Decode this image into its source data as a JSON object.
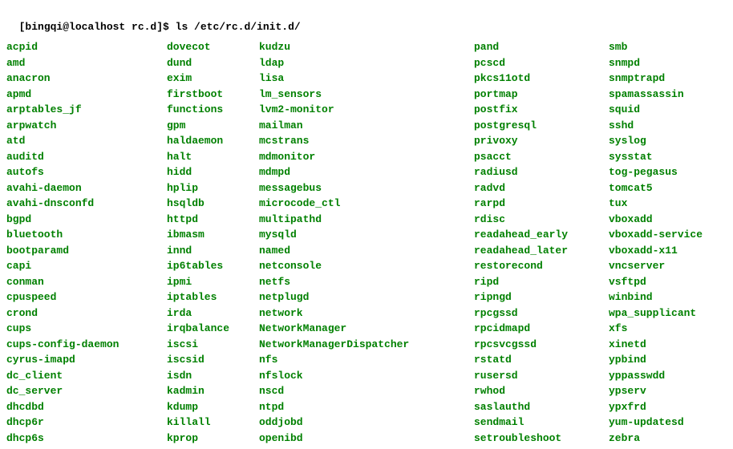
{
  "prompt": {
    "user_host": "[bingqi@localhost rc.d]$",
    "command": "ls /etc/rc.d/init.d/"
  },
  "columns": [
    [
      "acpid",
      "amd",
      "anacron",
      "apmd",
      "arptables_jf",
      "arpwatch",
      "atd",
      "auditd",
      "autofs",
      "avahi-daemon",
      "avahi-dnsconfd",
      "bgpd",
      "bluetooth",
      "bootparamd",
      "capi",
      "conman",
      "cpuspeed",
      "crond",
      "cups",
      "cups-config-daemon",
      "cyrus-imapd",
      "dc_client",
      "dc_server",
      "dhcdbd",
      "dhcp6r",
      "dhcp6s"
    ],
    [
      "dovecot",
      "dund",
      "exim",
      "firstboot",
      "functions",
      "gpm",
      "haldaemon",
      "halt",
      "hidd",
      "hplip",
      "hsqldb",
      "httpd",
      "ibmasm",
      "innd",
      "ip6tables",
      "ipmi",
      "iptables",
      "irda",
      "irqbalance",
      "iscsi",
      "iscsid",
      "isdn",
      "kadmin",
      "kdump",
      "killall",
      "kprop"
    ],
    [
      "kudzu",
      "ldap",
      "lisa",
      "lm_sensors",
      "lvm2-monitor",
      "mailman",
      "mcstrans",
      "mdmonitor",
      "mdmpd",
      "messagebus",
      "microcode_ctl",
      "multipathd",
      "mysqld",
      "named",
      "netconsole",
      "netfs",
      "netplugd",
      "network",
      "NetworkManager",
      "NetworkManagerDispatcher",
      "nfs",
      "nfslock",
      "nscd",
      "ntpd",
      "oddjobd",
      "openibd"
    ],
    [
      "pand",
      "pcscd",
      "pkcs11otd",
      "portmap",
      "postfix",
      "postgresql",
      "privoxy",
      "psacct",
      "radiusd",
      "radvd",
      "rarpd",
      "rdisc",
      "readahead_early",
      "readahead_later",
      "restorecond",
      "ripd",
      "ripngd",
      "rpcgssd",
      "rpcidmapd",
      "rpcsvcgssd",
      "rstatd",
      "rusersd",
      "rwhod",
      "saslauthd",
      "sendmail",
      "setroubleshoot"
    ],
    [
      "smb",
      "snmpd",
      "snmptrapd",
      "spamassassin",
      "squid",
      "sshd",
      "syslog",
      "sysstat",
      "tog-pegasus",
      "tomcat5",
      "tux",
      "vboxadd",
      "vboxadd-service",
      "vboxadd-x11",
      "vncserver",
      "vsftpd",
      "winbind",
      "wpa_supplicant",
      "xfs",
      "xinetd",
      "ypbind",
      "yppasswdd",
      "ypserv",
      "ypxfrd",
      "yum-updatesd",
      "zebra"
    ]
  ]
}
